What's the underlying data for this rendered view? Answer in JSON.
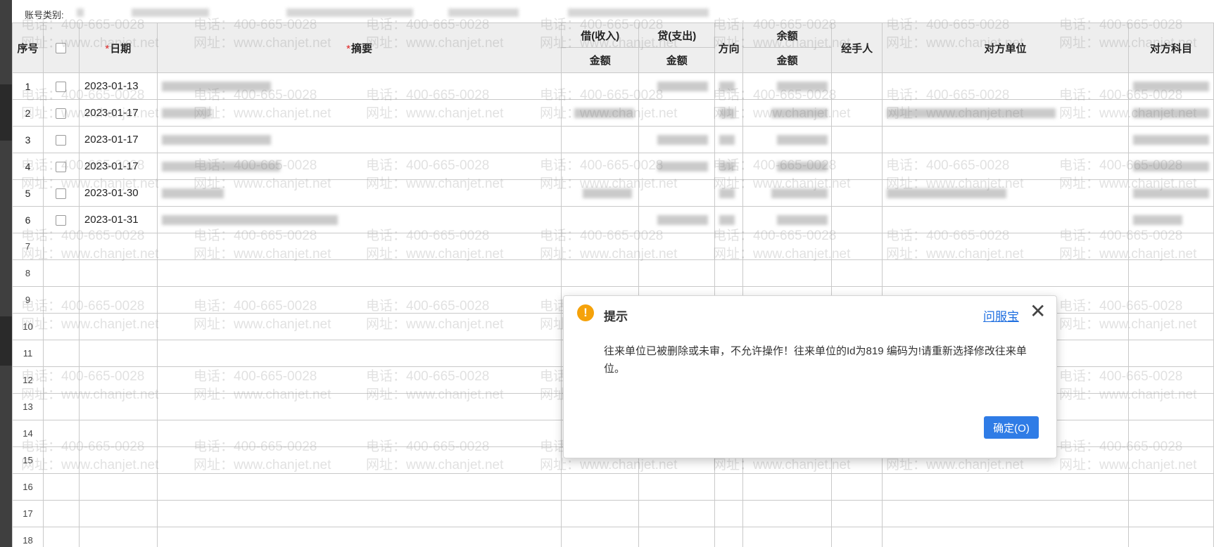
{
  "toolbar": {
    "account_type_label": "账号类别:"
  },
  "table": {
    "headers": {
      "seq": "序号",
      "date": "日期",
      "summary": "摘要",
      "debit_group": "借(收入)",
      "credit_group": "贷(支出)",
      "direction": "方向",
      "balance_group": "余额",
      "amount": "金额",
      "handler": "经手人",
      "counterparty": "对方单位",
      "counter_account": "对方科目"
    },
    "rows": [
      {
        "seq": "1",
        "date": "2023-01-13"
      },
      {
        "seq": "2",
        "date": "2023-01-17"
      },
      {
        "seq": "3",
        "date": "2023-01-17"
      },
      {
        "seq": "4",
        "date": "2023-01-17"
      },
      {
        "seq": "5",
        "date": "2023-01-30"
      },
      {
        "seq": "6",
        "date": "2023-01-31"
      }
    ],
    "empty_rows": [
      "7",
      "8",
      "9",
      "10",
      "11",
      "12",
      "13",
      "14",
      "15",
      "16",
      "17",
      "18"
    ]
  },
  "watermark": {
    "phone": "电话：400-665-0028",
    "site": "网址：www.chanjet.net"
  },
  "dialog": {
    "title": "提示",
    "help_link": "问服宝",
    "message": "往来单位已被删除或未审，不允许操作！往来单位的Id为819 编码为!请重新选择修改往来单位。",
    "ok_label": "确定(O)"
  },
  "colors": {
    "accent": "#2f7ce6",
    "warning": "#f5a20a",
    "required": "#e02020"
  },
  "icons": {
    "warning": "warning-icon",
    "close": "close-icon",
    "checkbox": "checkbox"
  }
}
